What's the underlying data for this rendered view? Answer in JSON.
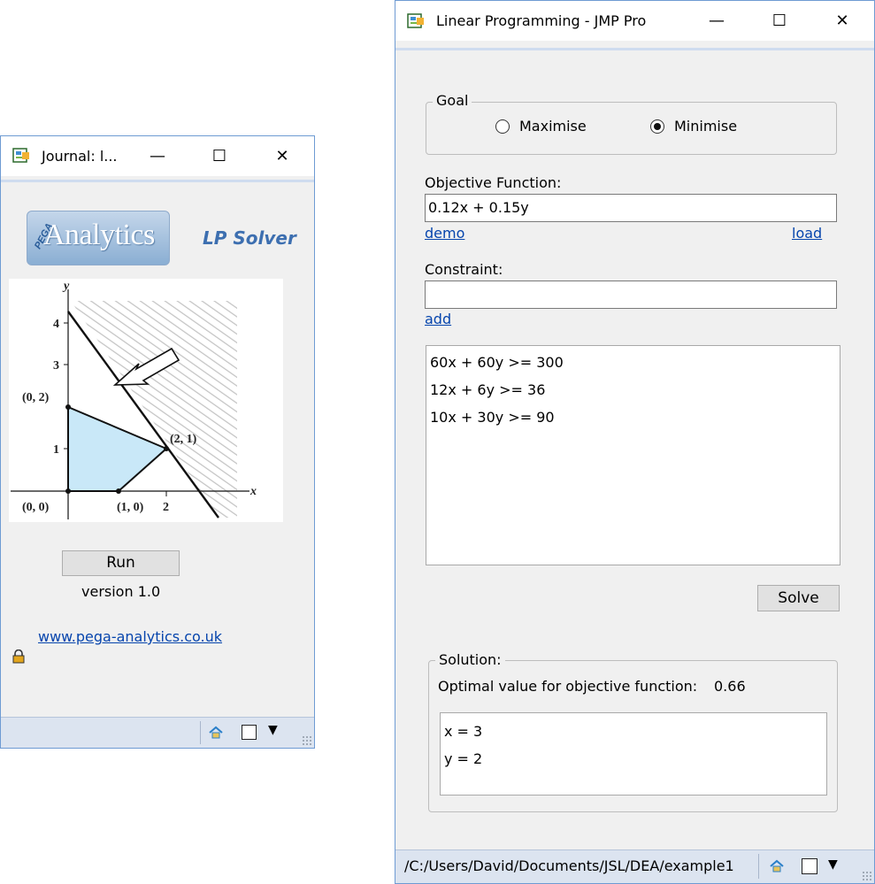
{
  "journal": {
    "title": "Journal: l...",
    "logo_text": "Analytics",
    "logo_prefix": "PEGA",
    "app_title": "LP Solver",
    "graph_labels": {
      "y_axis": "y",
      "x_axis": "x",
      "y_ticks": [
        "1",
        "3",
        "4"
      ],
      "x_tick": "2",
      "points": [
        "(0, 2)",
        "(2, 1)",
        "(0, 0)",
        "(1, 0)"
      ]
    },
    "run_label": "Run",
    "version": "version 1.0",
    "website": "www.pega-analytics.co.uk"
  },
  "lp": {
    "title": "Linear Programming - JMP Pro",
    "goal": {
      "label": "Goal",
      "options": [
        "Maximise",
        "Minimise"
      ],
      "selected": "Minimise"
    },
    "objective": {
      "label": "Objective Function:",
      "value": "0.12x + 0.15y",
      "demo_link": "demo",
      "load_link": "load"
    },
    "constraint": {
      "label": "Constraint:",
      "value": "",
      "add_link": "add"
    },
    "constraints_list": [
      "60x + 60y >= 300",
      "12x + 6y >= 36",
      "10x + 30y >= 90"
    ],
    "solve_label": "Solve",
    "solution": {
      "label": "Solution:",
      "optimal_text": "Optimal value for objective function:",
      "optimal_value": "0.66",
      "results": [
        "x = 3",
        "y = 2"
      ]
    },
    "status_path": "/C:/Users/David/Documents/JSL/DEA/example1"
  },
  "window_controls": {
    "minimize": "—",
    "maximize": "☐",
    "close": "✕"
  },
  "icons": [
    "app-icon",
    "lock-icon",
    "home-icon",
    "window-icon",
    "dropdown-icon",
    "resize-grip-icon"
  ],
  "colors": {
    "accent_border": "#6e9bd3",
    "link": "#0645ad",
    "feasible_fill": "#c9e8f8"
  }
}
